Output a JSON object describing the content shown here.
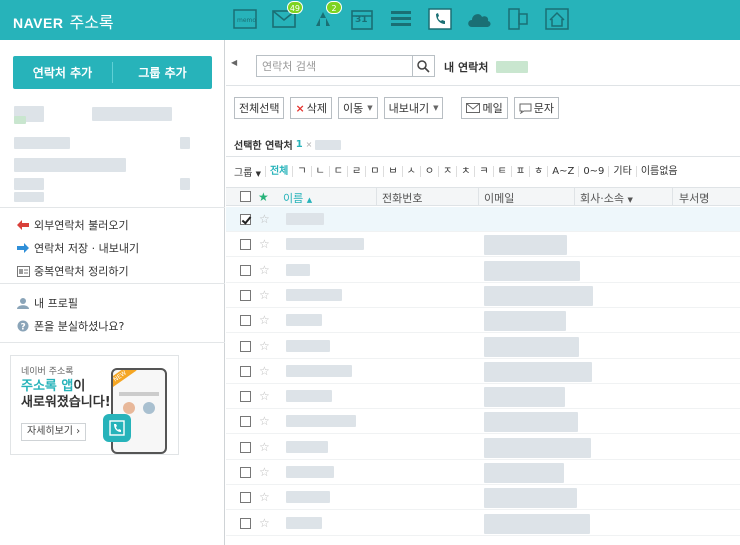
{
  "brand": {
    "naver": "NAVER",
    "app": "주소록"
  },
  "apps": [
    {
      "icon": "memo-icon",
      "badge": ""
    },
    {
      "icon": "mail-icon",
      "badge": "49"
    },
    {
      "icon": "cafe-icon",
      "badge": "2"
    },
    {
      "icon": "calendar-icon",
      "badge": ""
    },
    {
      "icon": "list-icon",
      "badge": ""
    },
    {
      "icon": "contacts-icon",
      "badge": ""
    },
    {
      "icon": "cloud-icon",
      "badge": ""
    },
    {
      "icon": "office-icon",
      "badge": ""
    },
    {
      "icon": "home-icon",
      "badge": ""
    }
  ],
  "calendar_day": "31",
  "sidebar": {
    "add_contact": "연락처 추가",
    "add_group": "그룹 추가",
    "links": [
      {
        "label": "외부연락처 불러오기",
        "icon": "import-arrow-icon"
      },
      {
        "label": "연락처 저장 · 내보내기",
        "icon": "export-arrow-icon"
      },
      {
        "label": "중복연락처 정리하기",
        "icon": "duplicate-icon"
      },
      {
        "label": "내 프로필",
        "icon": "profile-icon"
      },
      {
        "label": "폰을 분실하셨나요?",
        "icon": "help-icon"
      }
    ],
    "promo": {
      "small": "네이버 주소록",
      "title_accent": "주소록 앱",
      "title_rest1": "이",
      "title_line2": "새로워졌습니다!",
      "more": "자세히보기",
      "new_tag": "NEW"
    }
  },
  "main": {
    "search_placeholder": "연락처 검색",
    "my_contacts": "내 연락처",
    "toolbar": {
      "select_all": "전체선택",
      "delete": "삭제",
      "move": "이동",
      "export": "내보내기",
      "mail": "메일",
      "sms": "문자"
    },
    "selected_label": "선택한 연락처",
    "selected_count": "1",
    "index_label": "그룹",
    "index": [
      "전체",
      "ㄱ",
      "ㄴ",
      "ㄷ",
      "ㄹ",
      "ㅁ",
      "ㅂ",
      "ㅅ",
      "ㅇ",
      "ㅈ",
      "ㅊ",
      "ㅋ",
      "ㅌ",
      "ㅍ",
      "ㅎ",
      "A~Z",
      "0~9",
      "기타",
      "이름없음"
    ],
    "columns": {
      "name": "이름",
      "phone": "전화번호",
      "email": "이메일",
      "company": "회사·소속",
      "dept": "부서명"
    }
  },
  "colors": {
    "brand": "#27b3ba",
    "badge": "#7ed321",
    "delete": "#e5322d"
  }
}
